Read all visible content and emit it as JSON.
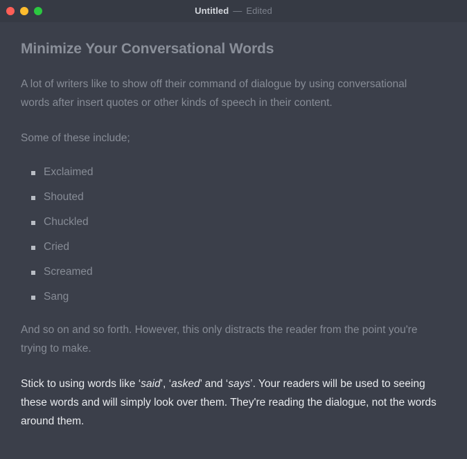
{
  "titlebar": {
    "window_controls": [
      {
        "name": "close",
        "color": "#ff5f57"
      },
      {
        "name": "minimize",
        "color": "#febc2e"
      },
      {
        "name": "zoom",
        "color": "#2bc840"
      }
    ],
    "document_name": "Untitled",
    "separator": "—",
    "edit_state": "Edited"
  },
  "document": {
    "heading": "Minimize Your Conversational Words",
    "paragraph_1": "A lot of writers like to show off their command of dialogue by using conversational words after insert quotes or other kinds of speech in their content.",
    "paragraph_2": "Some of these include;",
    "list_items": [
      "Exclaimed",
      "Shouted",
      "Chuckled",
      "Cried",
      "Screamed",
      "Sang"
    ],
    "paragraph_3": "And so on and so forth. However, this only distracts the reader from the point you're trying to make.",
    "paragraph_4": {
      "part_1": "Stick to using words like ‘",
      "em_1": "said",
      "part_2": "’, ‘",
      "em_2": "asked",
      "part_3": "’ and ‘",
      "em_3": "says",
      "part_4": "’. Your readers will be used to seeing these words and will simply look over them. They're reading the dialogue, not the words around them."
    }
  },
  "colors": {
    "window_background": "#3b3f4a",
    "titlebar_background": "#363a44",
    "muted_text": "#878c96",
    "heading_text": "#8a8f99",
    "bright_text": "#e9ebee",
    "bullet_marker": "#b9bdc4"
  }
}
